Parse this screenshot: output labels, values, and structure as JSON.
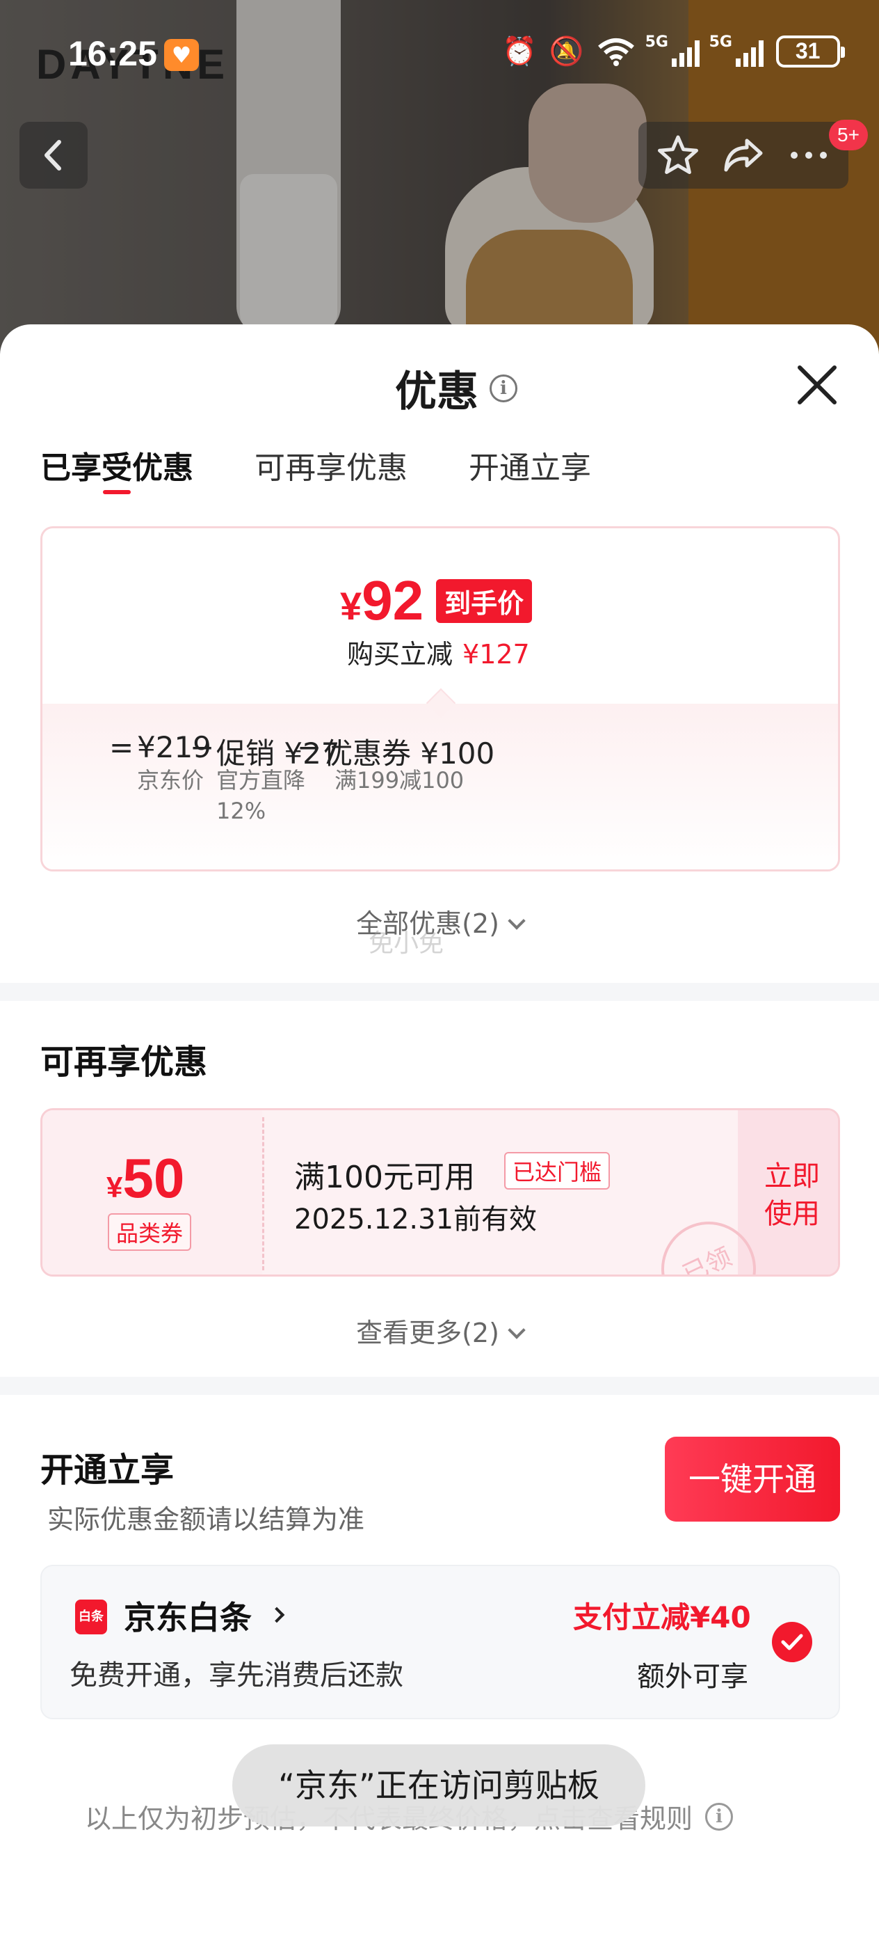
{
  "status_bar": {
    "time": "16:25",
    "network_1": "5G",
    "network_2": "5G",
    "battery": "31"
  },
  "hero": {
    "brand": "DAYTNE",
    "notification_badge": "5+"
  },
  "sheet": {
    "title": "优惠",
    "tabs": [
      {
        "label": "已享受优惠",
        "active": true
      },
      {
        "label": "可再享优惠",
        "active": false
      },
      {
        "label": "开通立享",
        "active": false
      }
    ]
  },
  "enjoyed": {
    "final_price": "92",
    "currency": "¥",
    "final_price_tag": "到手价",
    "save_label": "购买立减",
    "save_value": "¥127",
    "formula": {
      "equals": "=",
      "jd_price": "¥219",
      "jd_price_label": "京东价",
      "minus_1": "−",
      "promo": "促销 ¥27",
      "promo_sub": "官方直降\n12%",
      "minus_2": "−",
      "coupon": "优惠券 ¥100",
      "coupon_sub": "满199减100"
    },
    "all_offers": "全部优惠(2)",
    "watermark": "免小免"
  },
  "more_offers": {
    "title": "可再享优惠",
    "coupon": {
      "currency": "¥",
      "amount": "50",
      "type": "品类券",
      "condition": "满100元可用",
      "reached_badge": "已达门槛",
      "validity": "2025.12.31前有效",
      "action": "立即使用",
      "stamp": "已领"
    },
    "see_more": "查看更多(2)"
  },
  "open_now": {
    "title": "开通立享",
    "subtitle": "实际优惠金额请以结算为准",
    "button": "一键开通",
    "baitiao": {
      "logo_text": "白条",
      "name": "京东白条",
      "desc": "免费开通，享先消费后还款",
      "pay_discount": "支付立减¥40",
      "extra": "额外可享"
    }
  },
  "footnote": "以上仅为初步预估，不代表最终价格，点击查看规则",
  "toast": "“京东”正在访问剪贴板",
  "colors": {
    "accent_red": "#f2192d",
    "divider": "#f5f6f8"
  }
}
